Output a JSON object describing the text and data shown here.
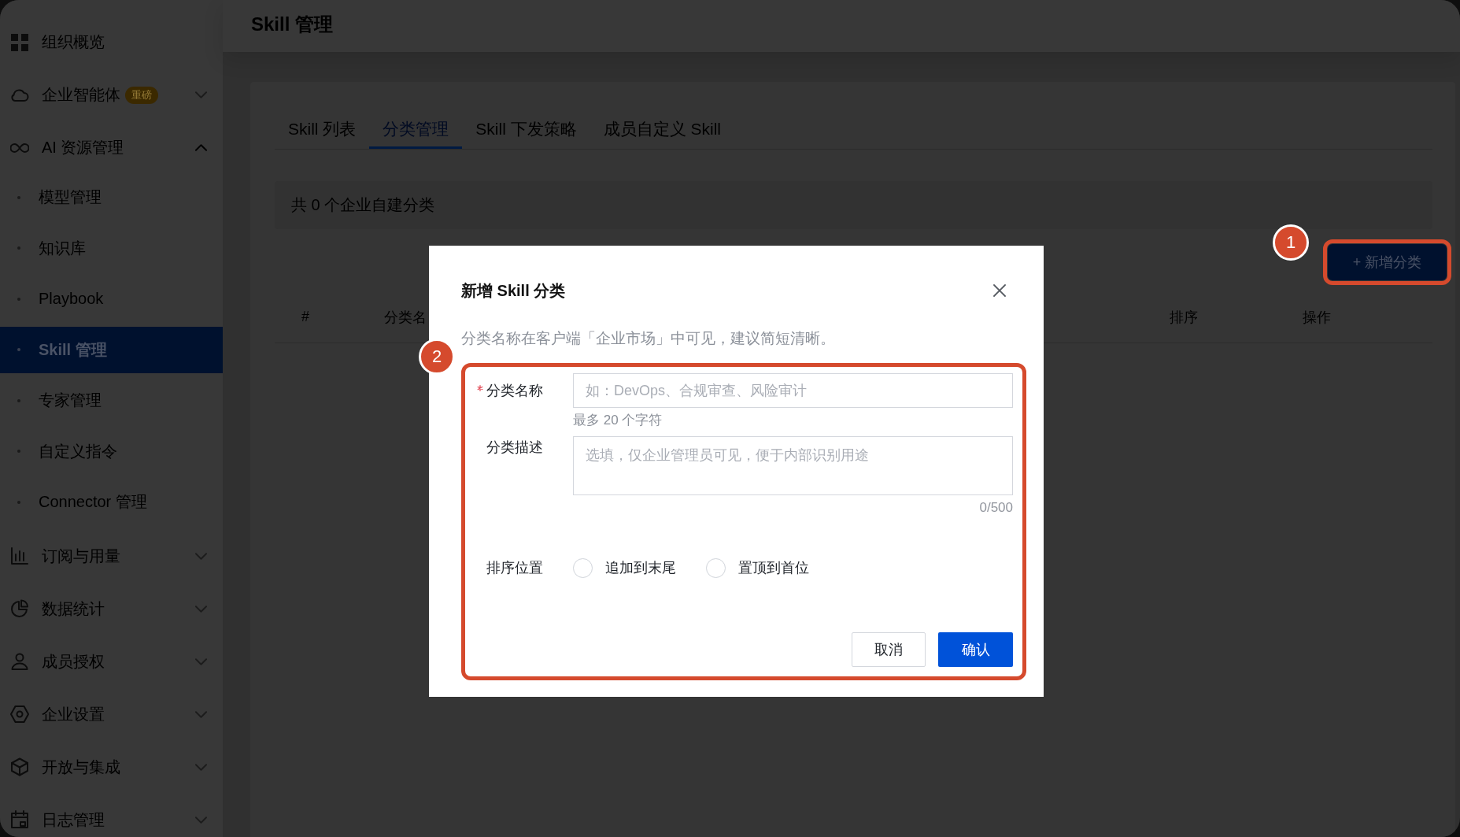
{
  "sidebar": {
    "items": [
      {
        "kind": "link",
        "label": "组织概览",
        "selected": false
      },
      {
        "kind": "group",
        "label": "企业智能体",
        "badge": "重磅",
        "expanded": false,
        "selected": false
      },
      {
        "kind": "group",
        "label": "AI 资源管理",
        "expanded": true,
        "selected": false,
        "children": [
          {
            "label": "模型管理",
            "selected": false
          },
          {
            "label": "知识库",
            "selected": false
          },
          {
            "label": "Playbook",
            "selected": false
          },
          {
            "label": "Skill 管理",
            "selected": true
          },
          {
            "label": "专家管理",
            "selected": false
          },
          {
            "label": "自定义指令",
            "selected": false
          },
          {
            "label": "Connector 管理",
            "selected": false
          }
        ]
      },
      {
        "kind": "group",
        "label": "订阅与用量",
        "expanded": false,
        "selected": false
      },
      {
        "kind": "group",
        "label": "数据统计",
        "expanded": false,
        "selected": false
      },
      {
        "kind": "group",
        "label": "成员授权",
        "expanded": false,
        "selected": false
      },
      {
        "kind": "group",
        "label": "企业设置",
        "expanded": false,
        "selected": false
      },
      {
        "kind": "group",
        "label": "开放与集成",
        "expanded": false,
        "selected": false
      },
      {
        "kind": "group",
        "label": "日志管理",
        "expanded": false,
        "selected": false
      }
    ]
  },
  "page_header": {
    "title": "Skill 管理"
  },
  "tabs": [
    {
      "label": "Skill 列表",
      "selected": false
    },
    {
      "label": "分类管理",
      "selected": true
    },
    {
      "label": "Skill 下发策略",
      "selected": false
    },
    {
      "label": "成员自定义 Skill",
      "selected": false
    }
  ],
  "summary": "共 0 个企业自建分类",
  "toolbar": {
    "callout": "1",
    "add_button": {
      "label": "+ 新增分类"
    }
  },
  "table": {
    "columns": [
      "#",
      "分类名",
      "排序",
      "操作"
    ]
  },
  "dialog": {
    "title": "新增 Skill 分类",
    "description": "分类名称在客户端「企业市场」中可见，建议简短清晰。",
    "callout": "2",
    "fields": [
      {
        "kind": "input",
        "label": "分类名称",
        "required": true,
        "placeholder": "如：DevOps、合规审查、风险审计",
        "hint": "最多 20 个字符"
      },
      {
        "kind": "textarea",
        "label": "分类描述",
        "required": false,
        "placeholder": "选填，仅企业管理员可见，便于内部识别用途",
        "counter": "0/500"
      },
      {
        "kind": "radio",
        "label": "排序位置",
        "required": false,
        "options": [
          {
            "label": "追加到末尾",
            "selected": false
          },
          {
            "label": "置顶到首位",
            "selected": false
          }
        ]
      }
    ],
    "buttons": [
      {
        "kind": "secondary",
        "label": "取消"
      },
      {
        "kind": "primary",
        "label": "确认"
      }
    ]
  }
}
